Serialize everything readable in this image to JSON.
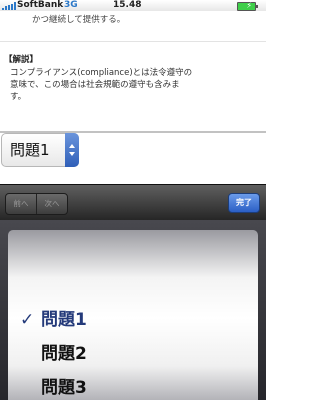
{
  "status_bar": {
    "carrier": "SoftBank",
    "network": "3G",
    "time": "15.48",
    "charging_symbol": "⚡",
    "battery_color": "#3fcf4a"
  },
  "content": {
    "cut_off_text": "かつ継続して提供する。",
    "explanation_heading": "【解説】",
    "explanation_body": "コンプライアンス(compliance)とは法令遵守の\n意味で、この場合は社会規範の遵守も含みま\nす。",
    "select": {
      "value": "問題1",
      "accent_color": "#2f5fb8"
    }
  },
  "toolbar": {
    "prev_label": "前へ",
    "next_label": "次へ",
    "done_label": "完了"
  },
  "picker": {
    "check_mark": "✓",
    "options": [
      "問題1",
      "問題2",
      "問題3"
    ],
    "selected_index": 0
  }
}
